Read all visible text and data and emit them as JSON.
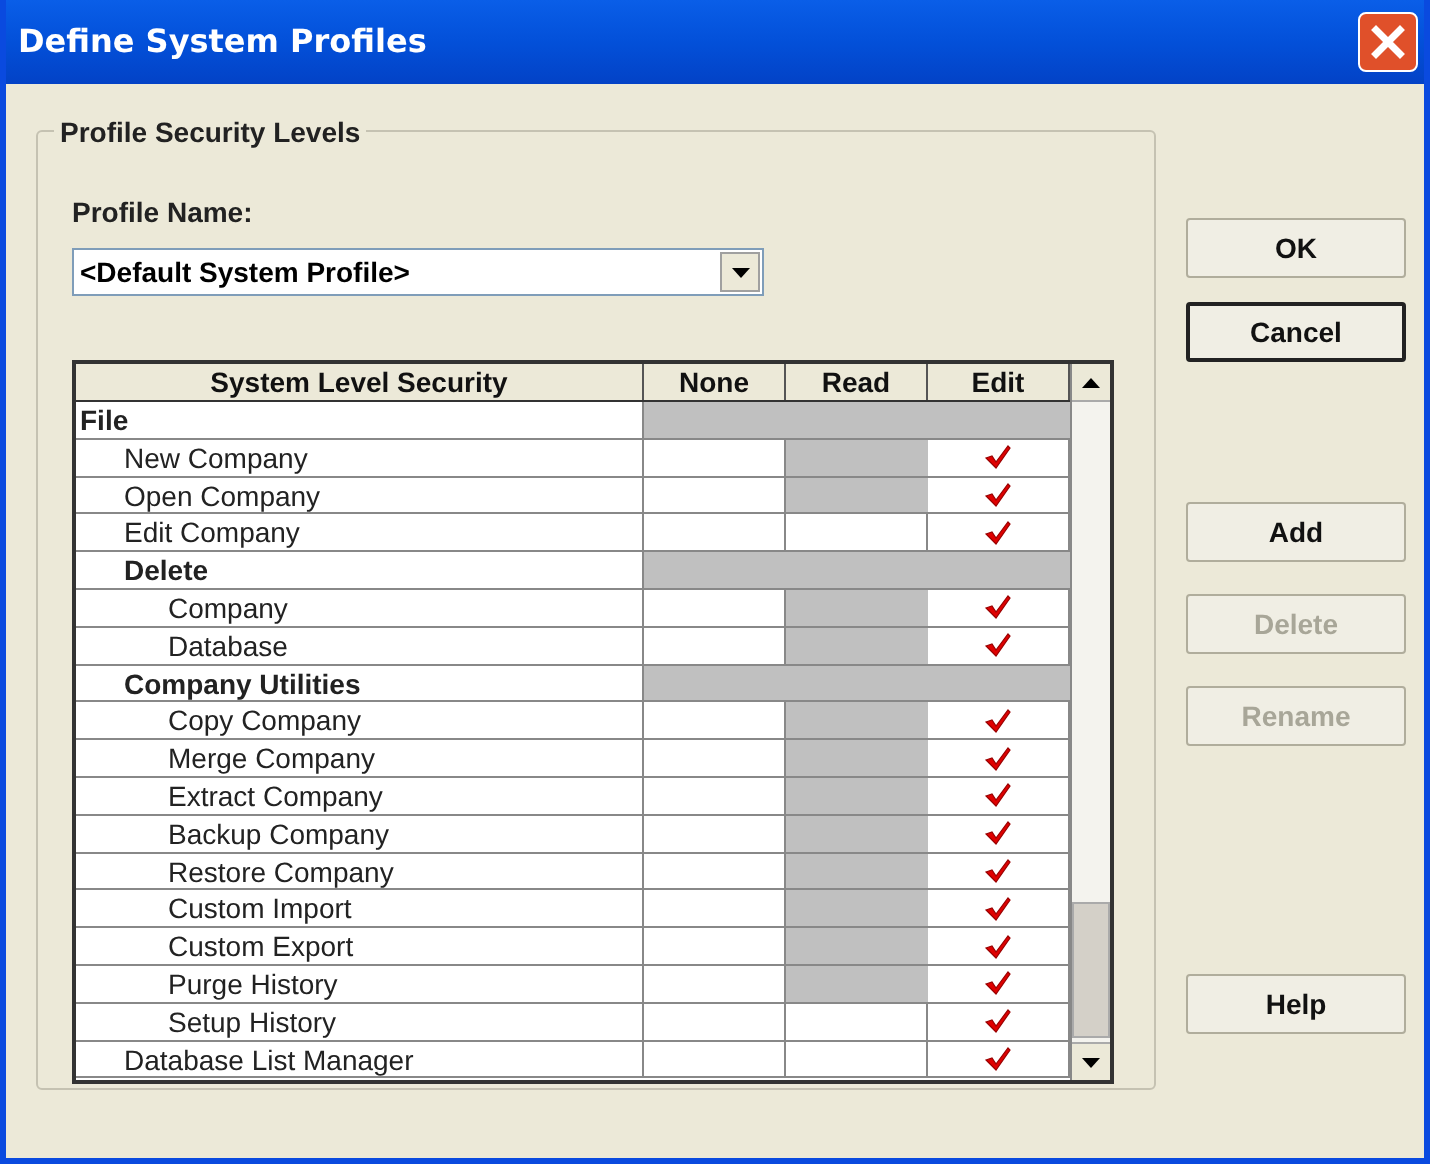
{
  "window": {
    "title": "Define System Profiles"
  },
  "group": {
    "title": "Profile Security Levels"
  },
  "profile": {
    "label": "Profile Name:",
    "value": "<Default System Profile>"
  },
  "table": {
    "columns": [
      "System Level Security",
      "None",
      "Read",
      "Edit"
    ],
    "rows": [
      {
        "kind": "group",
        "label": "File",
        "children": [
          {
            "kind": "item",
            "label": "New Company",
            "levels": [
              {
                "enabled": true,
                "checked": false
              },
              {
                "enabled": false,
                "checked": false
              },
              {
                "enabled": true,
                "checked": true
              }
            ]
          },
          {
            "kind": "item",
            "label": "Open Company",
            "levels": [
              {
                "enabled": true,
                "checked": false
              },
              {
                "enabled": false,
                "checked": false
              },
              {
                "enabled": true,
                "checked": true
              }
            ]
          },
          {
            "kind": "item",
            "label": "Edit Company",
            "levels": [
              {
                "enabled": true,
                "checked": false
              },
              {
                "enabled": true,
                "checked": false
              },
              {
                "enabled": true,
                "checked": true
              }
            ]
          },
          {
            "kind": "group",
            "label": "Delete",
            "children": [
              {
                "kind": "item",
                "label": "Company",
                "levels": [
                  {
                    "enabled": true,
                    "checked": false
                  },
                  {
                    "enabled": false,
                    "checked": false
                  },
                  {
                    "enabled": true,
                    "checked": true
                  }
                ]
              },
              {
                "kind": "item",
                "label": "Database",
                "levels": [
                  {
                    "enabled": true,
                    "checked": false
                  },
                  {
                    "enabled": false,
                    "checked": false
                  },
                  {
                    "enabled": true,
                    "checked": true
                  }
                ]
              }
            ]
          },
          {
            "kind": "group",
            "label": "Company Utilities",
            "children": [
              {
                "kind": "item",
                "label": "Copy Company",
                "levels": [
                  {
                    "enabled": true,
                    "checked": false
                  },
                  {
                    "enabled": false,
                    "checked": false
                  },
                  {
                    "enabled": true,
                    "checked": true
                  }
                ]
              },
              {
                "kind": "item",
                "label": "Merge Company",
                "levels": [
                  {
                    "enabled": true,
                    "checked": false
                  },
                  {
                    "enabled": false,
                    "checked": false
                  },
                  {
                    "enabled": true,
                    "checked": true
                  }
                ]
              },
              {
                "kind": "item",
                "label": "Extract Company",
                "levels": [
                  {
                    "enabled": true,
                    "checked": false
                  },
                  {
                    "enabled": false,
                    "checked": false
                  },
                  {
                    "enabled": true,
                    "checked": true
                  }
                ]
              },
              {
                "kind": "item",
                "label": "Backup Company",
                "levels": [
                  {
                    "enabled": true,
                    "checked": false
                  },
                  {
                    "enabled": false,
                    "checked": false
                  },
                  {
                    "enabled": true,
                    "checked": true
                  }
                ]
              },
              {
                "kind": "item",
                "label": "Restore Company",
                "levels": [
                  {
                    "enabled": true,
                    "checked": false
                  },
                  {
                    "enabled": false,
                    "checked": false
                  },
                  {
                    "enabled": true,
                    "checked": true
                  }
                ]
              },
              {
                "kind": "item",
                "label": "Custom Import",
                "levels": [
                  {
                    "enabled": true,
                    "checked": false
                  },
                  {
                    "enabled": false,
                    "checked": false
                  },
                  {
                    "enabled": true,
                    "checked": true
                  }
                ]
              },
              {
                "kind": "item",
                "label": "Custom Export",
                "levels": [
                  {
                    "enabled": true,
                    "checked": false
                  },
                  {
                    "enabled": false,
                    "checked": false
                  },
                  {
                    "enabled": true,
                    "checked": true
                  }
                ]
              },
              {
                "kind": "item",
                "label": "Purge History",
                "levels": [
                  {
                    "enabled": true,
                    "checked": false
                  },
                  {
                    "enabled": false,
                    "checked": false
                  },
                  {
                    "enabled": true,
                    "checked": true
                  }
                ]
              },
              {
                "kind": "item",
                "label": "Setup History",
                "levels": [
                  {
                    "enabled": true,
                    "checked": false
                  },
                  {
                    "enabled": true,
                    "checked": false
                  },
                  {
                    "enabled": true,
                    "checked": true
                  }
                ]
              }
            ]
          },
          {
            "kind": "item",
            "label": "Database List Manager",
            "levels": [
              {
                "enabled": true,
                "checked": false
              },
              {
                "enabled": true,
                "checked": false
              },
              {
                "enabled": true,
                "checked": true
              }
            ]
          }
        ]
      }
    ]
  },
  "buttons": [
    {
      "label": "OK",
      "disabled": false,
      "default": false
    },
    {
      "label": "Cancel",
      "disabled": false,
      "default": true
    },
    {
      "label": "Add",
      "disabled": false,
      "default": false
    },
    {
      "label": "Delete",
      "disabled": true,
      "default": false
    },
    {
      "label": "Rename",
      "disabled": true,
      "default": false
    },
    {
      "label": "Help",
      "disabled": false,
      "default": false
    }
  ]
}
